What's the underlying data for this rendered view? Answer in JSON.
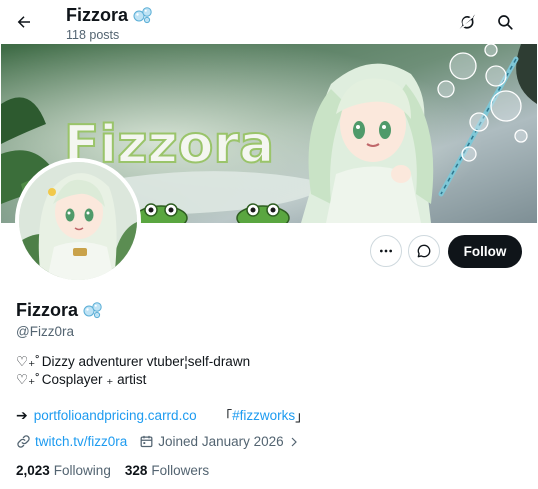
{
  "header": {
    "title": "Fizzora",
    "post_count": "118 posts"
  },
  "banner": {
    "logo_text": "Fizzora"
  },
  "actions": {
    "follow_label": "Follow"
  },
  "profile": {
    "display_name": "Fizzora",
    "handle": "@Fizz0ra",
    "bio_lines": [
      "Dizzy adventurer vtuber¦self-drawn",
      "Cosplayer ₊ artist"
    ],
    "bio_prefix": "♡₊˚",
    "link_arrow": "➔",
    "website": "portfolioandpricing.carrd.co",
    "bracket_open": "「",
    "hashtag": "#fizzworks",
    "bracket_close": "」",
    "twitch": "twitch.tv/fizz0ra",
    "joined": "Joined January 2026",
    "following_count": "2,023",
    "following_label": "Following",
    "followers_count": "328",
    "followers_label": "Followers"
  },
  "colors": {
    "link": "#1d9bf0",
    "follow_bg": "#0f1419",
    "muted": "#536471"
  },
  "icons": [
    "back-arrow-icon",
    "bubbles-icon",
    "grok-icon",
    "search-icon",
    "more-icon",
    "message-icon",
    "link-icon",
    "calendar-icon",
    "chevron-right-icon"
  ]
}
